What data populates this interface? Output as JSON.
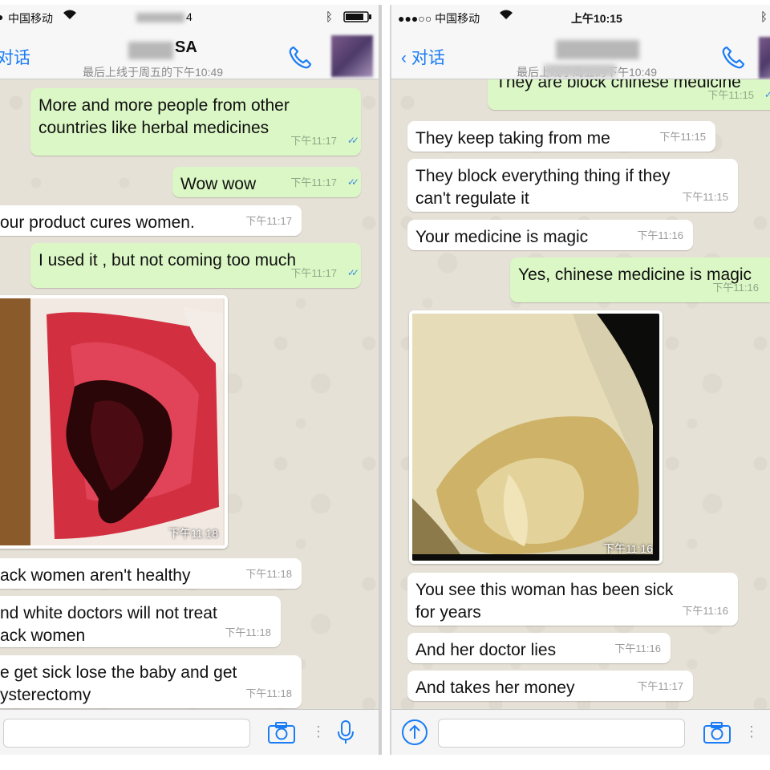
{
  "colors": {
    "link": "#1a7cf5",
    "outgoing": "#dbf7c5",
    "incoming": "#ffffff",
    "read_ticks": "#3d8de0"
  },
  "left": {
    "status": {
      "carrier": "中国移动",
      "time_fragment": "4"
    },
    "nav": {
      "back": "对话",
      "title_fragment": "SA",
      "last_seen": "最后上线于周五的下午10:49"
    },
    "messages": [
      {
        "type": "out",
        "lines": [
          "More and more people from other",
          "countries like herbal medicines"
        ],
        "time": "下午11:17"
      },
      {
        "type": "out",
        "lines": [
          "Wow wow"
        ],
        "time": "下午11:17"
      },
      {
        "type": "in",
        "lines": [
          "our product cures women."
        ],
        "time": "下午11:17"
      },
      {
        "type": "out",
        "lines": [
          "I used it , but not coming too much"
        ],
        "time": "下午11:17"
      },
      {
        "type": "photo",
        "time": "下午11:18"
      },
      {
        "type": "in",
        "lines": [
          "ack women aren't healthy"
        ],
        "time": "下午11:18"
      },
      {
        "type": "in",
        "lines": [
          "nd white doctors will not treat",
          "ack women"
        ],
        "time": "下午11:18"
      },
      {
        "type": "in",
        "lines": [
          "e get sick lose the baby and get",
          "ysterectomy"
        ],
        "time": "下午11:18"
      }
    ]
  },
  "right": {
    "status": {
      "carrier": "●●●○○ 中国移动",
      "time": "上午10:15"
    },
    "nav": {
      "back": "对话",
      "last_seen": "最后上线于周五的下午10:49"
    },
    "messages": [
      {
        "type": "out",
        "lines": [
          "They are block chinese medicine"
        ],
        "time": "下午11:15"
      },
      {
        "type": "in",
        "lines": [
          "They keep taking from me"
        ],
        "time": "下午11:15"
      },
      {
        "type": "in",
        "lines": [
          "They block everything thing if they",
          "can't regulate it"
        ],
        "time": "下午11:15"
      },
      {
        "type": "in",
        "lines": [
          "Your medicine is magic"
        ],
        "time": "下午11:16"
      },
      {
        "type": "out",
        "lines": [
          "Yes, chinese medicine is magic"
        ],
        "time": "下午11:16"
      },
      {
        "type": "photo",
        "time": "下午11:16"
      },
      {
        "type": "in",
        "lines": [
          "You see this woman has been sick",
          "for years"
        ],
        "time": "下午11:16"
      },
      {
        "type": "in",
        "lines": [
          "And her doctor lies"
        ],
        "time": "下午11:16"
      },
      {
        "type": "in",
        "lines": [
          "And takes her money"
        ],
        "time": "下午11:17"
      }
    ]
  }
}
